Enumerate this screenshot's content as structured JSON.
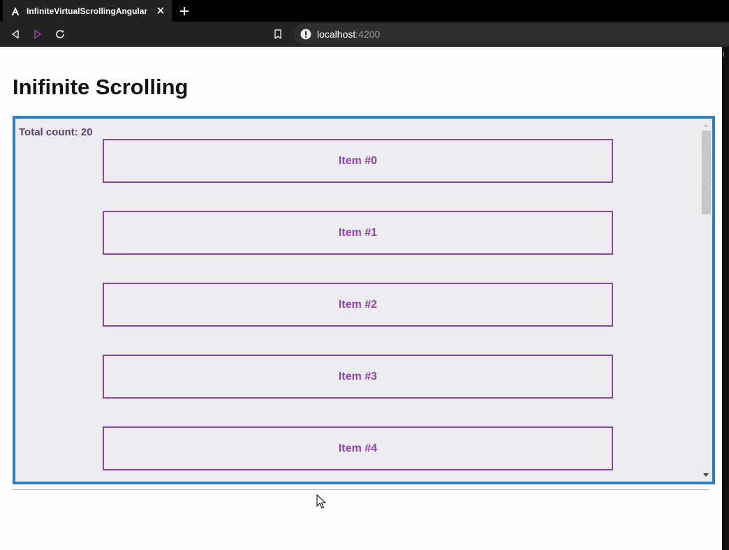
{
  "browser": {
    "tab": {
      "title": "InfiniteVirtualScrollingAngular",
      "favicon": "angular-icon"
    },
    "toolbar": {
      "back": "back-icon",
      "forward": "forward-icon",
      "reload": "reload-icon",
      "bookmark": "bookmark-icon"
    },
    "address": {
      "host": "localhost",
      "port": ":4200",
      "info_icon": "info-icon"
    }
  },
  "page": {
    "title": "Inifinite Scrolling",
    "total_count": "Total count: 20",
    "items": [
      "Item #0",
      "Item #1",
      "Item #2",
      "Item #3",
      "Item #4"
    ]
  },
  "colors": {
    "border_blue": "#2c7fc4",
    "item_purple": "#8e44ad",
    "panel_bg": "#ededef"
  }
}
